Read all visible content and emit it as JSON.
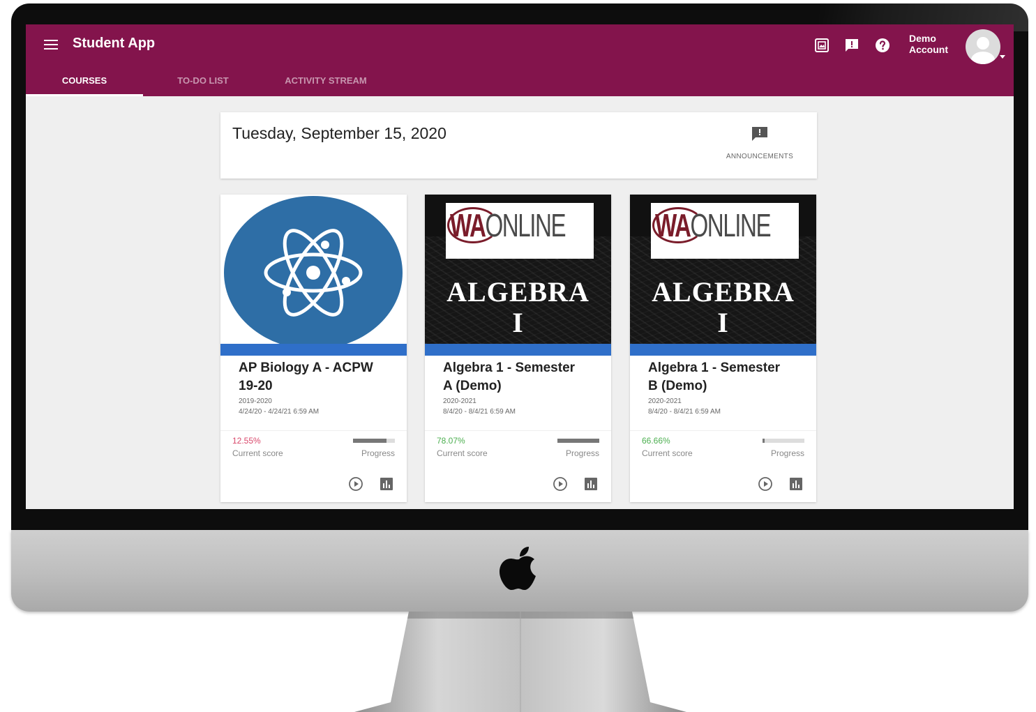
{
  "app": {
    "title": "Student App",
    "brand_color": "#83144c"
  },
  "tabs": [
    {
      "label": "COURSES",
      "active": true
    },
    {
      "label": "TO-DO LIST",
      "active": false
    },
    {
      "label": "ACTIVITY STREAM",
      "active": false
    }
  ],
  "header": {
    "account_line1": "Demo",
    "account_line2": "Account",
    "icons": [
      "gallery-icon",
      "feedback-icon",
      "help-icon",
      "avatar"
    ]
  },
  "date_card": {
    "date": "Tuesday, September 15, 2020",
    "announcements_label": "ANNOUNCEMENTS"
  },
  "courses": [
    {
      "name_line1": "AP Biology A - ACPW",
      "name_line2": "19-20",
      "term": "2019-2020",
      "dates": "4/24/20 - 4/24/21 6:59 AM",
      "score": "12.55%",
      "score_color": "#d9486b",
      "score_label": "Current score",
      "progress": 0.8,
      "progress_label": "Progress",
      "thumbnail": "atom-icon"
    },
    {
      "name_line1": "Algebra 1 - Semester",
      "name_line2": "A (Demo)",
      "term": "2020-2021",
      "dates": "8/4/20 - 8/4/21 6:59 AM",
      "score": "78.07%",
      "score_color": "#4caf50",
      "score_label": "Current score",
      "progress": 1.0,
      "progress_label": "Progress",
      "thumbnail_logo_a": "WA",
      "thumbnail_logo_b": "ONLINE",
      "thumbnail_title_1": "ALGEBRA",
      "thumbnail_title_2": "I"
    },
    {
      "name_line1": "Algebra 1 - Semester",
      "name_line2": "B (Demo)",
      "term": "2020-2021",
      "dates": "8/4/20 - 8/4/21 6:59 AM",
      "score": "66.66%",
      "score_color": "#4caf50",
      "score_label": "Current score",
      "progress": 0.05,
      "progress_label": "Progress",
      "thumbnail_logo_a": "WA",
      "thumbnail_logo_b": "ONLINE",
      "thumbnail_title_1": "ALGEBRA",
      "thumbnail_title_2": "I"
    }
  ]
}
